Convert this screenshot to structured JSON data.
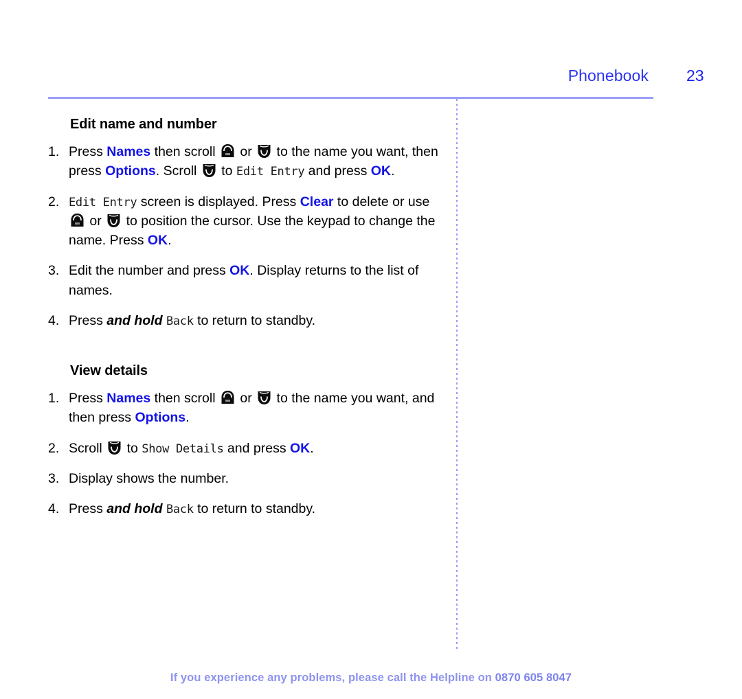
{
  "header": {
    "title": "Phonebook",
    "page_number": "23",
    "title_color": "#2b33f0"
  },
  "sections": [
    {
      "heading": "Edit name and number",
      "steps": [
        {
          "number": "1.",
          "parts": [
            {
              "t": "Press ",
              "s": "plain"
            },
            {
              "t": "Names",
              "s": "key"
            },
            {
              "t": " then scroll ",
              "s": "plain"
            },
            {
              "t": "scroll-up-icon",
              "s": "icon"
            },
            {
              "t": " or ",
              "s": "plain"
            },
            {
              "t": "scroll-down-icon",
              "s": "icon"
            },
            {
              "t": " to the name you want, then press ",
              "s": "plain"
            },
            {
              "t": "Options",
              "s": "key"
            },
            {
              "t": ". Scroll ",
              "s": "plain"
            },
            {
              "t": "scroll-down-icon",
              "s": "icon"
            },
            {
              "t": " to ",
              "s": "plain"
            },
            {
              "t": "Edit Entry",
              "s": "lcd"
            },
            {
              "t": " and press ",
              "s": "plain"
            },
            {
              "t": "OK",
              "s": "key"
            },
            {
              "t": ".",
              "s": "plain"
            }
          ]
        },
        {
          "number": "2.",
          "parts": [
            {
              "t": "Edit Entry",
              "s": "lcd"
            },
            {
              "t": " screen is displayed. Press ",
              "s": "plain"
            },
            {
              "t": "Clear",
              "s": "key"
            },
            {
              "t": " to delete or use ",
              "s": "plain"
            },
            {
              "t": "scroll-up-icon",
              "s": "icon"
            },
            {
              "t": " or ",
              "s": "plain"
            },
            {
              "t": "scroll-down-icon",
              "s": "icon"
            },
            {
              "t": " to position the cursor. Use the keypad to change the name. Press ",
              "s": "plain"
            },
            {
              "t": "OK",
              "s": "key"
            },
            {
              "t": ".",
              "s": "plain"
            }
          ]
        },
        {
          "number": "3.",
          "parts": [
            {
              "t": "Edit the number and press ",
              "s": "plain"
            },
            {
              "t": "OK",
              "s": "key"
            },
            {
              "t": ". Display returns to the list of names.",
              "s": "plain"
            }
          ]
        },
        {
          "number": "4.",
          "parts": [
            {
              "t": "Press ",
              "s": "plain"
            },
            {
              "t": "and hold",
              "s": "bolditalic"
            },
            {
              "t": " ",
              "s": "plain"
            },
            {
              "t": "Back",
              "s": "lcd"
            },
            {
              "t": " to return to standby.",
              "s": "plain"
            }
          ]
        }
      ]
    },
    {
      "heading": "View details",
      "steps": [
        {
          "number": "1.",
          "parts": [
            {
              "t": "Press ",
              "s": "plain"
            },
            {
              "t": "Names",
              "s": "key"
            },
            {
              "t": " then scroll ",
              "s": "plain"
            },
            {
              "t": "scroll-up-icon",
              "s": "icon"
            },
            {
              "t": " or ",
              "s": "plain"
            },
            {
              "t": "scroll-down-icon",
              "s": "icon"
            },
            {
              "t": " to the name you want, and then press ",
              "s": "plain"
            },
            {
              "t": "Options",
              "s": "key"
            },
            {
              "t": ".",
              "s": "plain"
            }
          ]
        },
        {
          "number": "2.",
          "parts": [
            {
              "t": "Scroll ",
              "s": "plain"
            },
            {
              "t": "scroll-down-icon",
              "s": "icon"
            },
            {
              "t": " to ",
              "s": "plain"
            },
            {
              "t": "Show Details",
              "s": "lcd"
            },
            {
              "t": " and press ",
              "s": "plain"
            },
            {
              "t": "OK",
              "s": "key"
            },
            {
              "t": ".",
              "s": "plain"
            }
          ]
        },
        {
          "number": "3.",
          "parts": [
            {
              "t": "Display shows the number.",
              "s": "plain"
            }
          ]
        },
        {
          "number": "4.",
          "parts": [
            {
              "t": "Press ",
              "s": "plain"
            },
            {
              "t": "and hold",
              "s": "bolditalic"
            },
            {
              "t": " ",
              "s": "plain"
            },
            {
              "t": "Back",
              "s": "lcd"
            },
            {
              "t": " to return to standby.",
              "s": "plain"
            }
          ]
        }
      ]
    }
  ],
  "footer": {
    "text": "If you experience any problems, please call the Helpline on ",
    "phone": "0870 605 8047",
    "color": "#8f93f0"
  }
}
